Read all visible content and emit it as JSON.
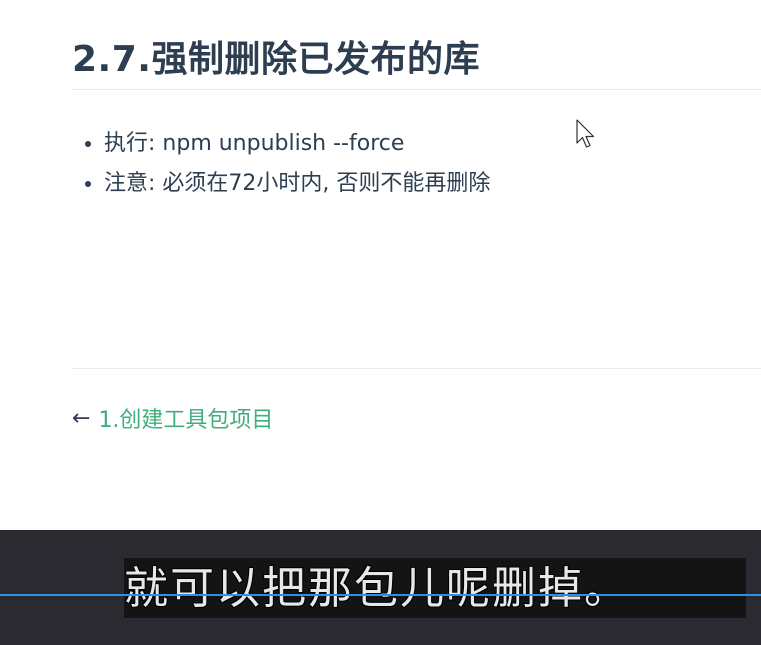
{
  "article": {
    "title": "2.7.强制删除已发布的库",
    "bullets": [
      "执行: npm unpublish --force",
      "注意: 必须在72小时内, 否则不能再删除"
    ]
  },
  "navigation": {
    "prev_arrow": "←",
    "prev_label": "1.创建工具包项目"
  },
  "subtitle": {
    "text": "就可以把那包儿呢删掉。"
  },
  "colors": {
    "text": "#2c3e50",
    "link": "#3eaf7c",
    "progress_line": "#2d8fe6"
  },
  "icons": {
    "cursor": "mouse-pointer-icon"
  }
}
